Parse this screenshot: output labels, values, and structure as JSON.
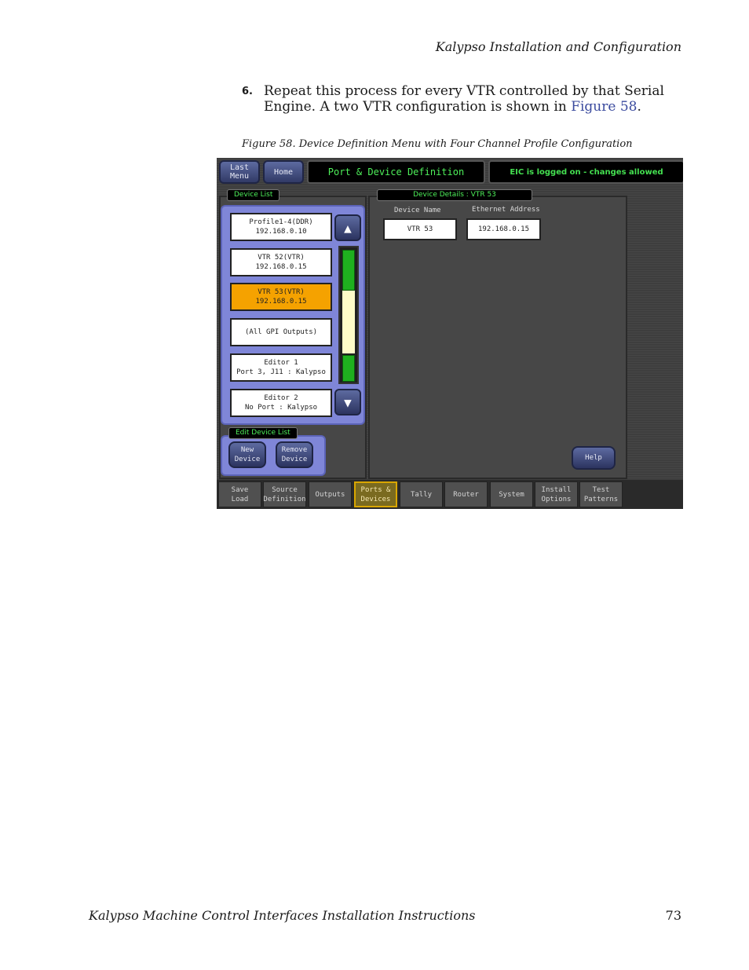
{
  "page": {
    "header": "Kalypso Installation and Configuration",
    "step_number": "6.",
    "step_text": "Repeat this process for every VTR controlled by that Serial Engine. A two VTR configuration is shown in ",
    "step_link": "Figure 58",
    "step_end": ".",
    "caption": "Figure 58.  Device Definition Menu with Four Channel Profile Configuration",
    "footer_title": "Kalypso Machine Control Interfaces Installation Instructions",
    "page_number": "73"
  },
  "ui": {
    "last_menu": "Last\nMenu",
    "home": "Home",
    "title": "Port & Device Definition",
    "status": "EIC is logged on - changes allowed",
    "device_list_tab": "Device List",
    "devices": [
      {
        "line1": "Profile1-4(DDR)",
        "line2": "192.168.0.10",
        "selected": false
      },
      {
        "line1": "VTR 52(VTR)",
        "line2": "192.168.0.15",
        "selected": false
      },
      {
        "line1": "VTR 53(VTR)",
        "line2": "192.168.0.15",
        "selected": true
      },
      {
        "line1": "(All GPI Outputs)",
        "line2": "",
        "selected": false
      },
      {
        "line1": "Editor 1",
        "line2": "Port 3, J11 : Kalypso",
        "selected": false
      },
      {
        "line1": "Editor 2",
        "line2": "No Port : Kalypso",
        "selected": false
      }
    ],
    "scroll_up_icon": "arrow-up-icon",
    "scroll_down_icon": "arrow-down-icon",
    "details_tab": "Device Details : VTR 53",
    "device_name_label": "Device Name",
    "device_name_value": "VTR 53",
    "ethernet_label": "Ethernet Address",
    "ethernet_value": "192.168.0.15",
    "edit_tab": "Edit Device List",
    "new_device": "New\nDevice",
    "remove_device": "Remove\nDevice",
    "help": "Help",
    "bottom_tabs": [
      {
        "label": "Save\nLoad",
        "active": false
      },
      {
        "label": "Source\nDefinition",
        "active": false
      },
      {
        "label": "Outputs",
        "active": false
      },
      {
        "label": "Ports &\nDevices",
        "active": true
      },
      {
        "label": "Tally",
        "active": false
      },
      {
        "label": "Router",
        "active": false
      },
      {
        "label": "System",
        "active": false
      },
      {
        "label": "Install\nOptions",
        "active": false
      },
      {
        "label": "Test\nPatterns",
        "active": false
      }
    ]
  }
}
